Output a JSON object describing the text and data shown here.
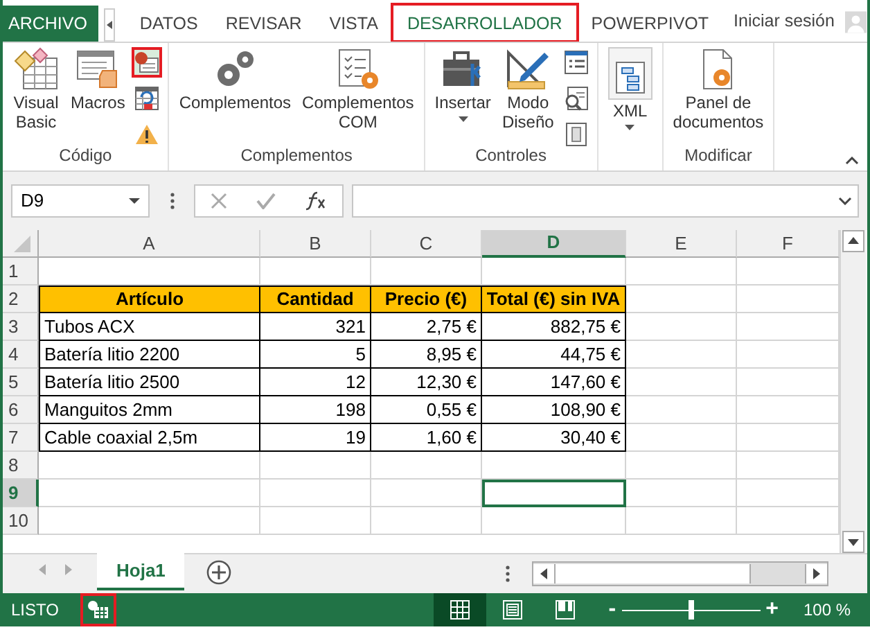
{
  "tabs": [
    {
      "label": "ARCHIVO",
      "kind": "file",
      "selected": false,
      "highlighted": false
    },
    {
      "label": "DATOS",
      "kind": "tab",
      "selected": false,
      "highlighted": false
    },
    {
      "label": "REVISAR",
      "kind": "tab",
      "selected": false,
      "highlighted": false
    },
    {
      "label": "VISTA",
      "kind": "tab",
      "selected": false,
      "highlighted": false
    },
    {
      "label": "DESARROLLADOR",
      "kind": "tab",
      "selected": true,
      "highlighted": true
    },
    {
      "label": "POWERPIVOT",
      "kind": "tab",
      "selected": false,
      "highlighted": false
    }
  ],
  "account": {
    "label": "Iniciar sesión"
  },
  "ribbon": {
    "groups": [
      {
        "label": "Código",
        "buttons": [
          {
            "kind": "large",
            "label": "Visual Basic",
            "dropdown": false
          },
          {
            "kind": "large",
            "label": "Macros",
            "dropdown": false
          },
          {
            "kind": "small-stack",
            "highlighted": [
              true,
              false,
              false
            ]
          }
        ]
      },
      {
        "label": "Complementos",
        "buttons": [
          {
            "kind": "large",
            "label": "Complementos",
            "dropdown": false
          },
          {
            "kind": "large",
            "label": "Complementos COM",
            "dropdown": false
          }
        ]
      },
      {
        "label": "Controles",
        "buttons": [
          {
            "kind": "large",
            "label": "Insertar",
            "dropdown": true
          },
          {
            "kind": "large",
            "label": "Modo Diseño",
            "dropdown": false
          },
          {
            "kind": "small-stack",
            "highlighted": [
              false,
              false,
              false
            ]
          }
        ]
      },
      {
        "buttons": [
          {
            "kind": "framed",
            "label": "XML",
            "dropdown": true
          }
        ]
      },
      {
        "label": "Modificar",
        "buttons": [
          {
            "kind": "large",
            "label": "Panel de documentos",
            "dropdown": false
          }
        ]
      }
    ]
  },
  "formula_bar": {
    "name_box": "D9"
  },
  "sheet": {
    "columns": [
      {
        "letter": "A",
        "selected": false
      },
      {
        "letter": "B",
        "selected": false
      },
      {
        "letter": "C",
        "selected": false
      },
      {
        "letter": "D",
        "selected": true
      },
      {
        "letter": "E",
        "selected": false
      },
      {
        "letter": "F",
        "selected": false
      }
    ],
    "rows": [
      {
        "number": "1",
        "kind": "empty",
        "selected": false
      },
      {
        "number": "2",
        "kind": "header",
        "selected": false,
        "cells": [
          "Artículo",
          "Cantidad",
          "Precio (€)",
          "Total (€) sin IVA"
        ]
      },
      {
        "number": "3",
        "kind": "data",
        "selected": false,
        "cells": [
          "Tubos ACX",
          "321",
          "2,75 €",
          "882,75 €"
        ]
      },
      {
        "number": "4",
        "kind": "data",
        "selected": false,
        "cells": [
          "Batería litio 2200",
          "5",
          "8,95 €",
          "44,75 €"
        ]
      },
      {
        "number": "5",
        "kind": "data",
        "selected": false,
        "cells": [
          "Batería litio 2500",
          "12",
          "12,30 €",
          "147,60 €"
        ]
      },
      {
        "number": "6",
        "kind": "data",
        "selected": false,
        "cells": [
          "Manguitos 2mm",
          "198",
          "0,55 €",
          "108,90 €"
        ]
      },
      {
        "number": "7",
        "kind": "data",
        "selected": false,
        "cells": [
          "Cable coaxial 2,5m",
          "19",
          "1,60 €",
          "30,40 €"
        ]
      },
      {
        "number": "8",
        "kind": "empty",
        "selected": false
      },
      {
        "number": "9",
        "kind": "empty",
        "selected": true
      },
      {
        "number": "10",
        "kind": "empty",
        "selected": false
      }
    ]
  },
  "sheet_tabs": [
    {
      "label": "Hoja1",
      "selected": true
    }
  ],
  "status_bar": {
    "status": "LISTO",
    "macro_highlighted": true,
    "views": [
      {
        "selected": true
      },
      {
        "selected": false
      },
      {
        "selected": false
      }
    ],
    "zoom": {
      "minus": "-",
      "plus": "+",
      "level": 0.5,
      "reading": "100 %"
    }
  }
}
